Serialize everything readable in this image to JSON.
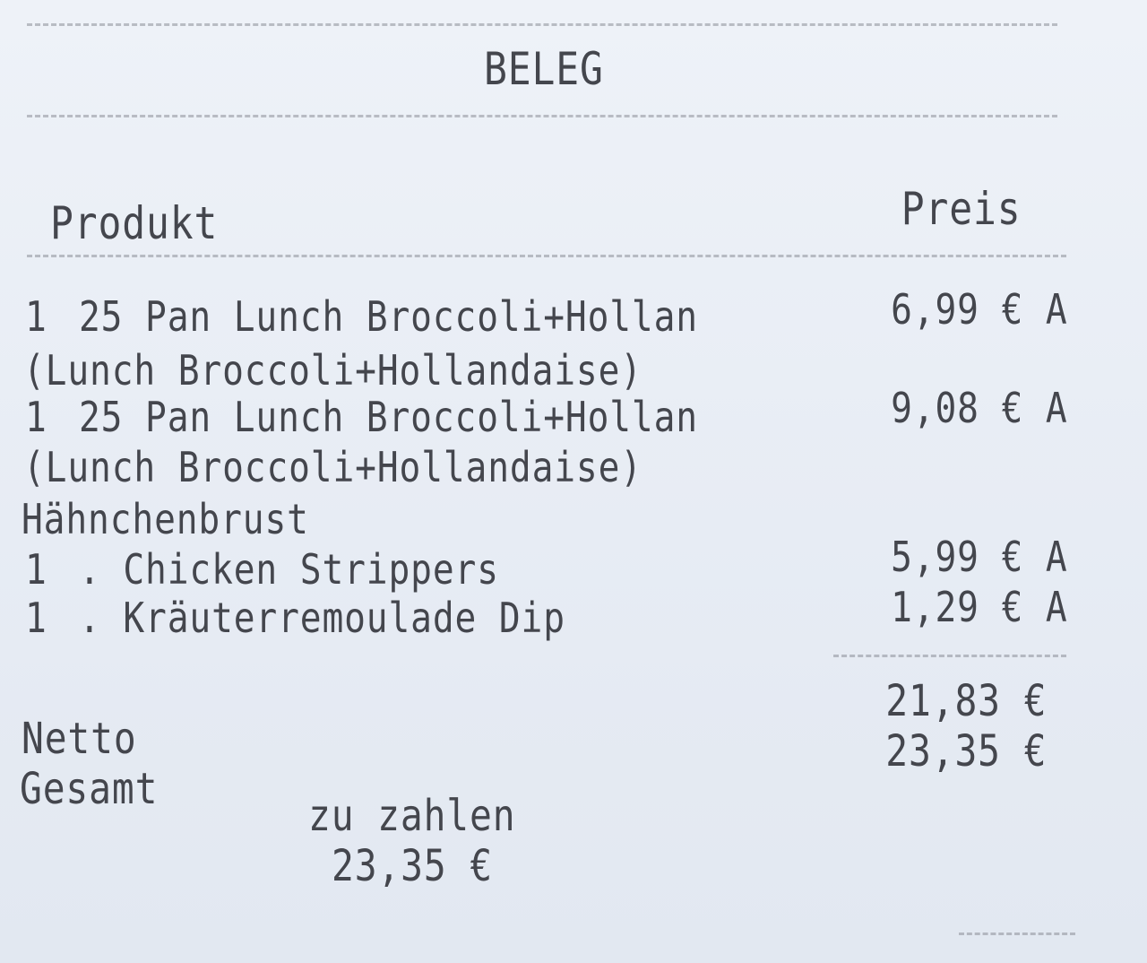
{
  "receipt": {
    "title": "BELEG",
    "columns": {
      "product": "Produkt",
      "price": "Preis"
    },
    "items": [
      {
        "qty": "1",
        "name": "25 Pan Lunch Broccoli+Hollan",
        "price": "6,99 € A"
      },
      {
        "detail": "(Lunch Broccoli+Hollandaise)"
      },
      {
        "qty": "1",
        "name": "25 Pan Lunch Broccoli+Hollan",
        "price": "9,08 € A"
      },
      {
        "detail": "(Lunch Broccoli+Hollandaise)"
      },
      {
        "detail": "Hähnchenbrust"
      },
      {
        "qty": "1",
        "name": ". Chicken Strippers",
        "price": "5,99 € A"
      },
      {
        "qty": "1",
        "name": ". Kräuterremoulade Dip",
        "price": "1,29 € A"
      }
    ],
    "totals": {
      "netto_label": "Netto",
      "netto_value": "21,83 €",
      "gesamt_label": "Gesamt",
      "gesamt_value": "23,35 €"
    },
    "payment": {
      "label": "zu zahlen",
      "value": "23,35 €"
    }
  }
}
